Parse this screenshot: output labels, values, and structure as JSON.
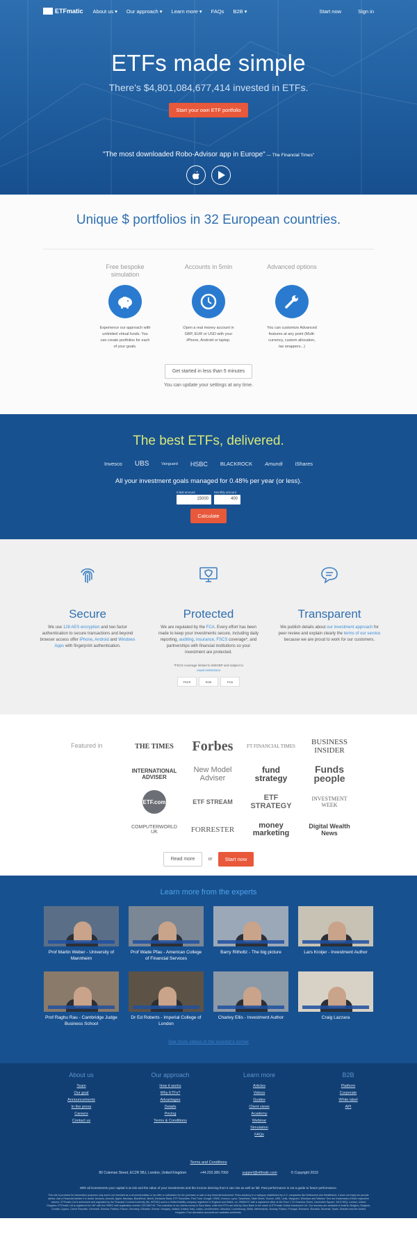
{
  "nav": {
    "logo": "ETFmatic",
    "items": [
      "About us",
      "Our approach",
      "Learn more",
      "FAQs",
      "B2B"
    ],
    "start": "Start now",
    "signin": "Sign in"
  },
  "hero": {
    "title": "ETFs made simple",
    "subtitle": "There's $4,801,084,677,414 invested in ETFs.",
    "cta": "Start your own ETF portfolio",
    "quote": "\"The most downloaded Robo-Advisor app in Europe\"",
    "quote_source": " — The Financial Times\""
  },
  "unique": {
    "title": "Unique $ portfolios in 32 European countries.",
    "features": [
      {
        "title": "Free bespoke simulation",
        "desc": "Experience our approach with unlimited virtual funds. You can create portfolios for each of your goals."
      },
      {
        "title": "Accounts in 5min",
        "desc": "Open a real money account in GBP, EUR or USD with your iPhone, Android or laptop."
      },
      {
        "title": "Advanced options",
        "desc": "You can customize Advanced features at any point (Multi-currency, custom allocation, tax wrappers...)"
      }
    ],
    "start_button": "Get started in less than 5 minutes",
    "note": "You can update your settings at any time."
  },
  "best": {
    "title": "The best ETFs, delivered.",
    "brands": [
      "Invesco",
      "UBS",
      "Vanguard",
      "HSBC",
      "BLACKROCK",
      "Amundi",
      "iShares"
    ],
    "goal_text": "All your investment goals managed for 0.48% per year (or less).",
    "initial_label": "Initial amount",
    "initial_value": "15000",
    "monthly_label": "Monthly amount",
    "monthly_value": "400",
    "calculate": "Calculate"
  },
  "secure": {
    "cols": [
      {
        "title": "Secure",
        "p1": "We use ",
        "l1": "128 AES encryption",
        "p2": " and two factor authentication to secure transactions and beyond browser access offer ",
        "l2": "iPhone",
        "p3": ", ",
        "l3": "Android",
        "p4": " and ",
        "l4": "Windows Apps",
        "p5": " with fingerprint authentication."
      },
      {
        "title": "Protected",
        "p1": "We are regulated by the ",
        "l1": "FCA",
        "p2": ". Every effort has been made to keep your investments secure, including daily reporting, ",
        "l2": "auditing",
        "p3": ", ",
        "l3": "insurance",
        "p4": ", ",
        "l4": "FSCS",
        "p5": " coverage*, and partnerships with financial institutions so your investment are protected."
      },
      {
        "title": "Transparent",
        "p1": "We publish details about ",
        "l1": "our investment approach",
        "p2": " for peer review and explain clearly the ",
        "l2": "terms of our service",
        "p3": " because we are proud to work for our customers.",
        "l3": "",
        "p4": "",
        "l4": "",
        "p5": ""
      }
    ],
    "fscs_note": "*FSCS coverage limited to 50kGBP and subject to",
    "fscs_link": "usual restrictions",
    "badges": [
      "FSCS",
      "ECB",
      "FCA"
    ]
  },
  "featured": {
    "label": "Featured in",
    "logos": [
      "THE TIMES",
      "Forbes",
      "FT FINANCIAL TIMES",
      "BUSINESS INSIDER",
      "INTERNATIONAL ADVISER",
      "New Model Adviser",
      "fund strategy",
      "Funds people",
      "ETF.com",
      "ETF STREAM",
      "ETF STRATEGY",
      "INVESTMENT WEEK",
      "COMPUTERWORLD UK",
      "FORRESTER",
      "money marketing",
      "Digital Wealth News"
    ],
    "read_more": "Read more",
    "or": "or",
    "start": "Start now"
  },
  "experts": {
    "title": "Learn more from the experts",
    "videos": [
      {
        "caption": "Prof Martin Weber - University of Mannheim",
        "bg": "#5a6f87"
      },
      {
        "caption": "Prof Wade Pfau - American College of Financial Services",
        "bg": "#7b8794"
      },
      {
        "caption": "Barry Ritholtz - The big picture",
        "bg": "#9aa8b8"
      },
      {
        "caption": "Lars Kroijer - Investment Author",
        "bg": "#c7c2b4"
      },
      {
        "caption": "Prof Raghu Rau - Cambridge Judge Business School",
        "bg": "#8a7a6a"
      },
      {
        "caption": "Dr Ed Roberts - Imperial College of London",
        "bg": "#5c5346"
      },
      {
        "caption": "Charley Ellis - Investment Author",
        "bg": "#8c99a6"
      },
      {
        "caption": "Craig Lazzara",
        "bg": "#d8d2c6"
      }
    ],
    "more_link": "See more videos in the investor's corner"
  },
  "footer": {
    "cols": [
      {
        "title": "About us",
        "links": [
          "Team",
          "Our goal",
          "Announcements",
          "In the press",
          "Careers",
          "Contact us"
        ]
      },
      {
        "title": "Our approach",
        "links": [
          "How it works",
          "Why ETFs?",
          "Advantages",
          "Details",
          "Pricing",
          "Terms & Conditions"
        ]
      },
      {
        "title": "Learn more",
        "links": [
          "Articles",
          "Videos",
          "Guides",
          "Client views",
          "Academy",
          "Webinar",
          "Simulation",
          "FAQs"
        ]
      },
      {
        "title": "B2B",
        "links": [
          "Platform",
          "Corporate",
          "White label",
          "API"
        ]
      }
    ],
    "terms": "Terms and Conditions",
    "address": "80 Coleman Street, EC2R 5BJ, London, United Kingdom",
    "phone": "+44.203.389.7060",
    "email": "support@etfmatic.com",
    "copyright": "© Copyright 2019",
    "risk": "With all investments your capital is at risk and the value of your investments and the income deriving from it can rise as well as fall. Past performance is not a guide to future performance.",
    "legal": "This site is provided for information purposes only and is not intended as a recommendation or an offer or solicitation for the purchase or sale of any financial instrument. Robo-advisory is a category established by U.S. companies like Betterment and Wealthfront, it does not imply we provide advice. Ask a Financial Adviser if in doubt. Amazon, Amundi, Apple, Barclays, BlackRock, Brexit, Deutsche Bank, ETF Securities, First Trust, Google, HSBC, Invesco, Lyxor, SaxoBank, State Street, Source, UBS, Ucits, Vanguard, Windows and Wisdom Tree are trademarks of their respective owners. ETFmatic Ltd is authorised and regulated by the Financial Conduct Authority (No. 657261) and is a limited liability company registered in England and Wales, no. 09606747 with a registered office at 4th Floor 7-10 Chandos Street, Cavendish Square, W1G 9DQ, London, United Kingdom. ETFmatic Ltd is registered for VAT with the HMRC with registration number 190 9987 82. The custodian of our clients money is Saxo Bank, while the ETFs are held by Saxo Bank in the name of ETFmatic Global Investment Ltd. Our services are available in Austria, Belgium, Bulgaria, Croatia, Cyprus, Czech Republic, Denmark, Estonia, Finland, France, Germany, Gibraltar, Greece, Hungary, Iceland, Ireland, Italy, Latvia, Liechtenstein, Lithuania, Luxembourg, Malta, Netherlands, Norway, Poland, Portugal, Romania, Slovakia, Slovenia, Spain, Sweden and the United Kingdom. Free simulation accounts are available worldwide."
  }
}
